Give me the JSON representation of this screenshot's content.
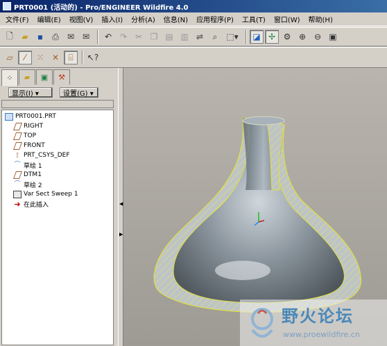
{
  "window": {
    "title": "PRT0001 (活动的) - Pro/ENGINEER Wildfire 4.0"
  },
  "menu": [
    "文件(F)",
    "编辑(E)",
    "视图(V)",
    "插入(I)",
    "分析(A)",
    "信息(N)",
    "应用程序(P)",
    "工具(T)",
    "窗口(W)",
    "帮助(H)"
  ],
  "toolbar1": {
    "buttons": [
      "new-file-icon",
      "open-folder-icon",
      "save-icon",
      "print-icon",
      "send-mail-icon",
      "mail-icon",
      "undo-icon",
      "redo-icon",
      "cut-icon",
      "copy-icon",
      "paste-icon",
      "paste-special-icon",
      "regenerate-icon",
      "find-icon",
      "selection-filter-icon",
      "repaint-icon",
      "spin-center-icon",
      "orient-icon",
      "zoom-in-icon",
      "zoom-out-icon",
      "refit-icon"
    ]
  },
  "toolbar2": {
    "buttons": [
      "datum-planes-icon",
      "datum-axes-icon",
      "datum-points-icon",
      "csys-icon",
      "annotation-icon",
      "context-help-icon"
    ]
  },
  "panel": {
    "show_label": "显示(I) ▾",
    "settings_label": "设置(G) ▾",
    "tree": [
      {
        "label": "PRT0001.PRT",
        "icon": "part-icon",
        "level": 0
      },
      {
        "label": "RIGHT",
        "icon": "datum-plane-icon",
        "level": 1
      },
      {
        "label": "TOP",
        "icon": "datum-plane-icon",
        "level": 1
      },
      {
        "label": "FRONT",
        "icon": "datum-plane-icon",
        "level": 1
      },
      {
        "label": "PRT_CSYS_DEF",
        "icon": "csys-icon",
        "level": 1
      },
      {
        "label": "草绘 1",
        "icon": "sketch-icon",
        "level": 1
      },
      {
        "label": "DTM1",
        "icon": "datum-plane-icon",
        "level": 1
      },
      {
        "label": "草绘 2",
        "icon": "sketch-icon",
        "level": 1
      },
      {
        "label": "Var Sect Sweep 1",
        "icon": "sweep-icon",
        "level": 1
      },
      {
        "label": "在此插入",
        "icon": "insert-here-icon",
        "level": 1
      }
    ]
  },
  "watermark": {
    "title": "野火论坛",
    "url": "www.proewildfire.cn"
  }
}
